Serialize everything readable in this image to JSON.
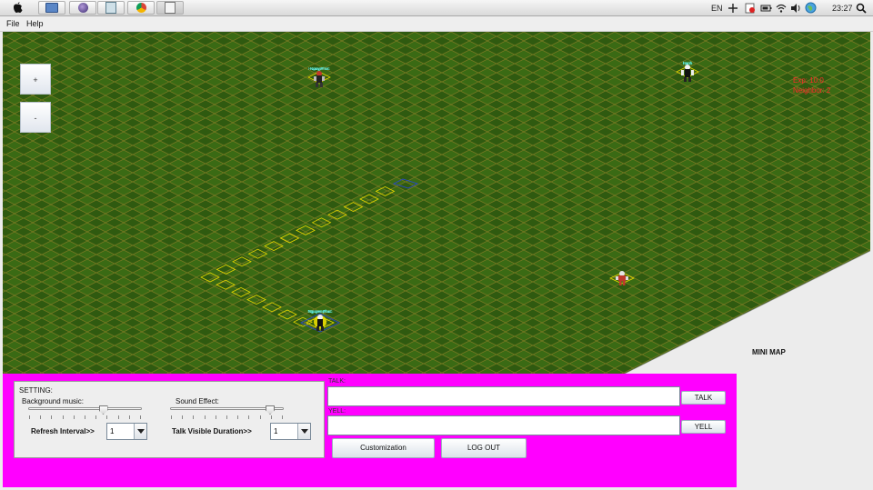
{
  "topbar": {
    "apps": [
      "apple-icon",
      "finder-icon",
      "eclipse-icon",
      "files-icon",
      "chrome-icon",
      "java-app-icon"
    ],
    "language": "EN",
    "time": "23:27"
  },
  "menubar": {
    "file": "File",
    "help": "Help"
  },
  "game": {
    "zoom_in": "+",
    "zoom_out": "-",
    "players": [
      {
        "name": "HoangPhuc",
        "sub": "Nguyen H"
      },
      {
        "name": "hanh",
        "sub": "Hanh"
      },
      {
        "name": "Nguyenphuc",
        "sub": "Nguyen Phuc"
      }
    ],
    "hud_lines": [
      "Exp: 10.0",
      "Neighbor: 2"
    ],
    "minimap_label": "MINI MAP"
  },
  "panel": {
    "setting_title": "SETTING:",
    "bg_music_label": "Background music:",
    "sound_effect_label": "Sound Effect:",
    "refresh_label": "Refresh Interval>>",
    "refresh_value": "1",
    "talk_duration_label": "Talk Visible Duration>>",
    "talk_duration_value": "1",
    "talk_label": "TALK:",
    "talk_button": "TALK",
    "yell_label": "YELL:",
    "yell_button": "YELL",
    "customization_button": "Customization",
    "logout_button": "LOG OUT",
    "bg_music_level": 0.66,
    "sound_effect_level": 0.88
  },
  "colors": {
    "panel": "#ff00ff",
    "grass": "#2f5a10",
    "grid": "#6b6b1a",
    "path": "#e8d800"
  }
}
